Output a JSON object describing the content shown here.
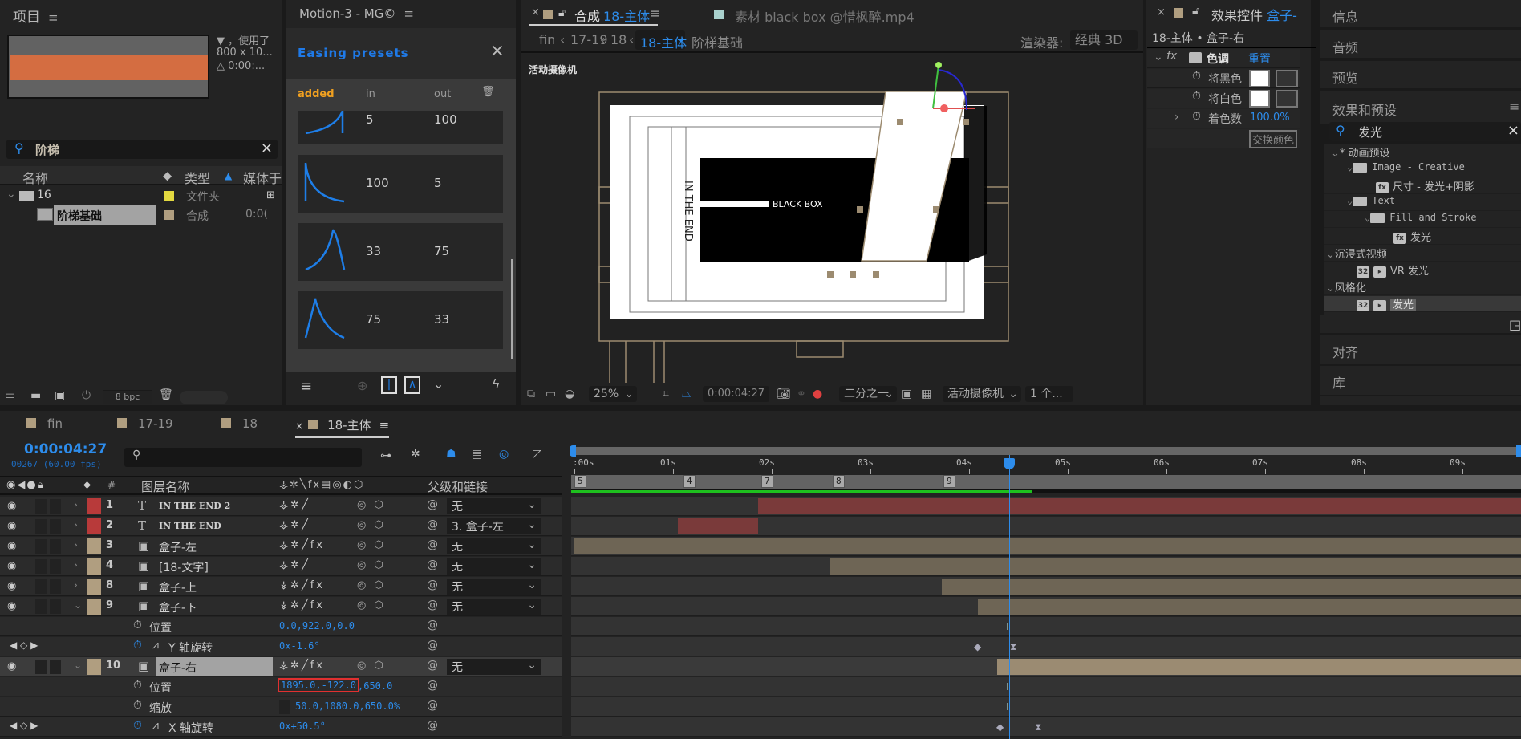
{
  "project": {
    "title": "项目",
    "info_line1": "▼ ，使用了",
    "info_line2": "800 x 10...",
    "info_line3": "△ 0:00:...",
    "search_value": "阶梯",
    "columns": [
      "名称",
      "类型",
      "媒体于"
    ],
    "rows": [
      {
        "name": "16",
        "type": "文件夹",
        "color": "#e3d940",
        "icon": "folder-icon"
      },
      {
        "name": "阶梯基础",
        "type": "合成",
        "color": "#b09e80",
        "icon": "composition-icon",
        "duration": "0:0("
      }
    ],
    "bpc": "8 bpc"
  },
  "motion": {
    "title": "Motion-3 - MG©",
    "easing_title": "Easing presets",
    "headers": {
      "added": "added",
      "in": "in",
      "out": "out"
    },
    "presets": [
      {
        "in": "5",
        "out": "100",
        "curve": "ease-in-spike"
      },
      {
        "in": "100",
        "out": "5",
        "curve": "ease-out-spike"
      },
      {
        "in": "33",
        "out": "75",
        "curve": "peak-late"
      },
      {
        "in": "75",
        "out": "33",
        "curve": "peak-early"
      }
    ]
  },
  "comp": {
    "tab_close": "×",
    "tab_label": "合成",
    "tab_name": "18-主体",
    "footage_tab": "素材 black box @惜枫醉.mp4",
    "breadcrumbs": [
      "fin",
      "17-19",
      "18",
      "18-主体",
      "阶梯基础"
    ],
    "renderer_label": "渲染器:",
    "renderer_value": "经典 3D",
    "camera_label": "活动摄像机",
    "canvas_text1": "BLACK BOX",
    "canvas_text2": "IN THE END",
    "zoom": "25%",
    "timecode": "0:00:04:27",
    "resolution": "二分之一",
    "view": "活动摄像机",
    "views_count": "1 个..."
  },
  "effects": {
    "title": "效果控件",
    "title_layer": "盒子-",
    "breadcrumb": "18-主体 • 盒子-右",
    "effect_name": "色调",
    "reset": "重置",
    "props": [
      {
        "label": "将黑色",
        "type": "color",
        "value": "#ffffff"
      },
      {
        "label": "将白色",
        "type": "color",
        "value": "#ffffff"
      },
      {
        "label": "着色数",
        "type": "value",
        "value": "100.0%"
      }
    ],
    "swap_button": "交换颜色"
  },
  "right": {
    "panels": [
      "信息",
      "音频",
      "预览",
      "效果和预设"
    ],
    "search_value": "发光",
    "tree": [
      {
        "label": "* 动画预设",
        "level": 0,
        "kind": "group"
      },
      {
        "label": "Image - Creative",
        "level": 1,
        "kind": "folder"
      },
      {
        "label": "尺寸 - 发光+阴影",
        "level": 2,
        "kind": "preset"
      },
      {
        "label": "Text",
        "level": 1,
        "kind": "folder"
      },
      {
        "label": "Fill and Stroke",
        "level": 2,
        "kind": "folder"
      },
      {
        "label": "发光",
        "level": 3,
        "kind": "preset"
      },
      {
        "label": "沉浸式视频",
        "level": 0,
        "kind": "group"
      },
      {
        "label": "VR 发光",
        "level": 1,
        "kind": "effect32"
      },
      {
        "label": "风格化",
        "level": 0,
        "kind": "group"
      },
      {
        "label": "发光",
        "level": 1,
        "kind": "effect32",
        "selected": true
      }
    ],
    "lower_panels": [
      "对齐",
      "库"
    ]
  },
  "timeline": {
    "tabs": [
      "fin",
      "17-19",
      "18",
      "18-主体"
    ],
    "active_tab": "18-主体",
    "timecode": "0:00:04:27",
    "frames": "00267 (60.00 fps)",
    "col_layer_name": "图层名称",
    "col_parent": "父级和链接",
    "col_num": "#",
    "ruler": [
      ":00s",
      "01s",
      "02s",
      "03s",
      "04s",
      "05s",
      "06s",
      "07s",
      "08s",
      "09s"
    ],
    "markers": [
      "5",
      "4",
      "7",
      "8",
      "9"
    ],
    "layers": [
      {
        "num": "1",
        "name": "IN THE END 2",
        "type": "text",
        "color": "#b83a3a",
        "parent": "无",
        "fx": false
      },
      {
        "num": "2",
        "name": "IN THE END",
        "type": "text",
        "color": "#b83a3a",
        "parent": "3. 盒子-左",
        "fx": false
      },
      {
        "num": "3",
        "name": "盒子-左",
        "type": "comp",
        "color": "#b09e80",
        "parent": "无",
        "fx": true
      },
      {
        "num": "4",
        "name": "[18-文字]",
        "type": "comp",
        "color": "#b09e80",
        "parent": "无",
        "fx": false
      },
      {
        "num": "8",
        "name": "盒子-上",
        "type": "comp",
        "color": "#b09e80",
        "parent": "无",
        "fx": true
      },
      {
        "num": "9",
        "name": "盒子-下",
        "type": "comp",
        "color": "#b09e80",
        "parent": "无",
        "fx": true
      }
    ],
    "layer9_props": [
      {
        "name": "位置",
        "value": "0.0,922.0,0.0"
      },
      {
        "name": "Y 轴旋转",
        "value": "0x-1.6°"
      }
    ],
    "layer10": {
      "num": "10",
      "name": "盒子-右",
      "color": "#b09e80",
      "parent": "无"
    },
    "layer10_props": [
      {
        "name": "位置",
        "value_highlight": "1895.0,-122.0",
        "value_rest": ",650.0"
      },
      {
        "name": "缩放",
        "value": "50.0,1080.0,650.0%"
      },
      {
        "name": "X 轴旋转",
        "value": "0x+50.5°"
      }
    ]
  }
}
